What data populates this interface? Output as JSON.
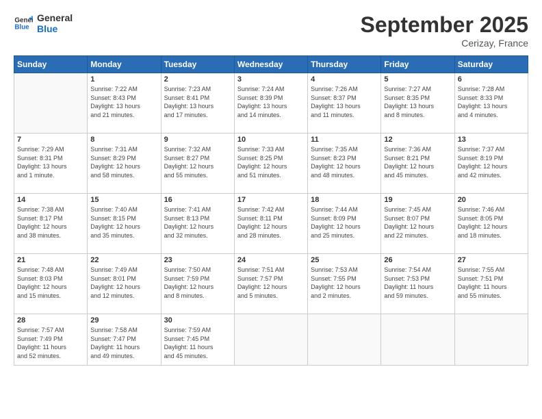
{
  "logo": {
    "line1": "General",
    "line2": "Blue"
  },
  "title": "September 2025",
  "location": "Cerizay, France",
  "days_header": [
    "Sunday",
    "Monday",
    "Tuesday",
    "Wednesday",
    "Thursday",
    "Friday",
    "Saturday"
  ],
  "weeks": [
    [
      {
        "num": "",
        "info": ""
      },
      {
        "num": "1",
        "info": "Sunrise: 7:22 AM\nSunset: 8:43 PM\nDaylight: 13 hours\nand 21 minutes."
      },
      {
        "num": "2",
        "info": "Sunrise: 7:23 AM\nSunset: 8:41 PM\nDaylight: 13 hours\nand 17 minutes."
      },
      {
        "num": "3",
        "info": "Sunrise: 7:24 AM\nSunset: 8:39 PM\nDaylight: 13 hours\nand 14 minutes."
      },
      {
        "num": "4",
        "info": "Sunrise: 7:26 AM\nSunset: 8:37 PM\nDaylight: 13 hours\nand 11 minutes."
      },
      {
        "num": "5",
        "info": "Sunrise: 7:27 AM\nSunset: 8:35 PM\nDaylight: 13 hours\nand 8 minutes."
      },
      {
        "num": "6",
        "info": "Sunrise: 7:28 AM\nSunset: 8:33 PM\nDaylight: 13 hours\nand 4 minutes."
      }
    ],
    [
      {
        "num": "7",
        "info": "Sunrise: 7:29 AM\nSunset: 8:31 PM\nDaylight: 13 hours\nand 1 minute."
      },
      {
        "num": "8",
        "info": "Sunrise: 7:31 AM\nSunset: 8:29 PM\nDaylight: 12 hours\nand 58 minutes."
      },
      {
        "num": "9",
        "info": "Sunrise: 7:32 AM\nSunset: 8:27 PM\nDaylight: 12 hours\nand 55 minutes."
      },
      {
        "num": "10",
        "info": "Sunrise: 7:33 AM\nSunset: 8:25 PM\nDaylight: 12 hours\nand 51 minutes."
      },
      {
        "num": "11",
        "info": "Sunrise: 7:35 AM\nSunset: 8:23 PM\nDaylight: 12 hours\nand 48 minutes."
      },
      {
        "num": "12",
        "info": "Sunrise: 7:36 AM\nSunset: 8:21 PM\nDaylight: 12 hours\nand 45 minutes."
      },
      {
        "num": "13",
        "info": "Sunrise: 7:37 AM\nSunset: 8:19 PM\nDaylight: 12 hours\nand 42 minutes."
      }
    ],
    [
      {
        "num": "14",
        "info": "Sunrise: 7:38 AM\nSunset: 8:17 PM\nDaylight: 12 hours\nand 38 minutes."
      },
      {
        "num": "15",
        "info": "Sunrise: 7:40 AM\nSunset: 8:15 PM\nDaylight: 12 hours\nand 35 minutes."
      },
      {
        "num": "16",
        "info": "Sunrise: 7:41 AM\nSunset: 8:13 PM\nDaylight: 12 hours\nand 32 minutes."
      },
      {
        "num": "17",
        "info": "Sunrise: 7:42 AM\nSunset: 8:11 PM\nDaylight: 12 hours\nand 28 minutes."
      },
      {
        "num": "18",
        "info": "Sunrise: 7:44 AM\nSunset: 8:09 PM\nDaylight: 12 hours\nand 25 minutes."
      },
      {
        "num": "19",
        "info": "Sunrise: 7:45 AM\nSunset: 8:07 PM\nDaylight: 12 hours\nand 22 minutes."
      },
      {
        "num": "20",
        "info": "Sunrise: 7:46 AM\nSunset: 8:05 PM\nDaylight: 12 hours\nand 18 minutes."
      }
    ],
    [
      {
        "num": "21",
        "info": "Sunrise: 7:48 AM\nSunset: 8:03 PM\nDaylight: 12 hours\nand 15 minutes."
      },
      {
        "num": "22",
        "info": "Sunrise: 7:49 AM\nSunset: 8:01 PM\nDaylight: 12 hours\nand 12 minutes."
      },
      {
        "num": "23",
        "info": "Sunrise: 7:50 AM\nSunset: 7:59 PM\nDaylight: 12 hours\nand 8 minutes."
      },
      {
        "num": "24",
        "info": "Sunrise: 7:51 AM\nSunset: 7:57 PM\nDaylight: 12 hours\nand 5 minutes."
      },
      {
        "num": "25",
        "info": "Sunrise: 7:53 AM\nSunset: 7:55 PM\nDaylight: 12 hours\nand 2 minutes."
      },
      {
        "num": "26",
        "info": "Sunrise: 7:54 AM\nSunset: 7:53 PM\nDaylight: 11 hours\nand 59 minutes."
      },
      {
        "num": "27",
        "info": "Sunrise: 7:55 AM\nSunset: 7:51 PM\nDaylight: 11 hours\nand 55 minutes."
      }
    ],
    [
      {
        "num": "28",
        "info": "Sunrise: 7:57 AM\nSunset: 7:49 PM\nDaylight: 11 hours\nand 52 minutes."
      },
      {
        "num": "29",
        "info": "Sunrise: 7:58 AM\nSunset: 7:47 PM\nDaylight: 11 hours\nand 49 minutes."
      },
      {
        "num": "30",
        "info": "Sunrise: 7:59 AM\nSunset: 7:45 PM\nDaylight: 11 hours\nand 45 minutes."
      },
      {
        "num": "",
        "info": ""
      },
      {
        "num": "",
        "info": ""
      },
      {
        "num": "",
        "info": ""
      },
      {
        "num": "",
        "info": ""
      }
    ]
  ]
}
